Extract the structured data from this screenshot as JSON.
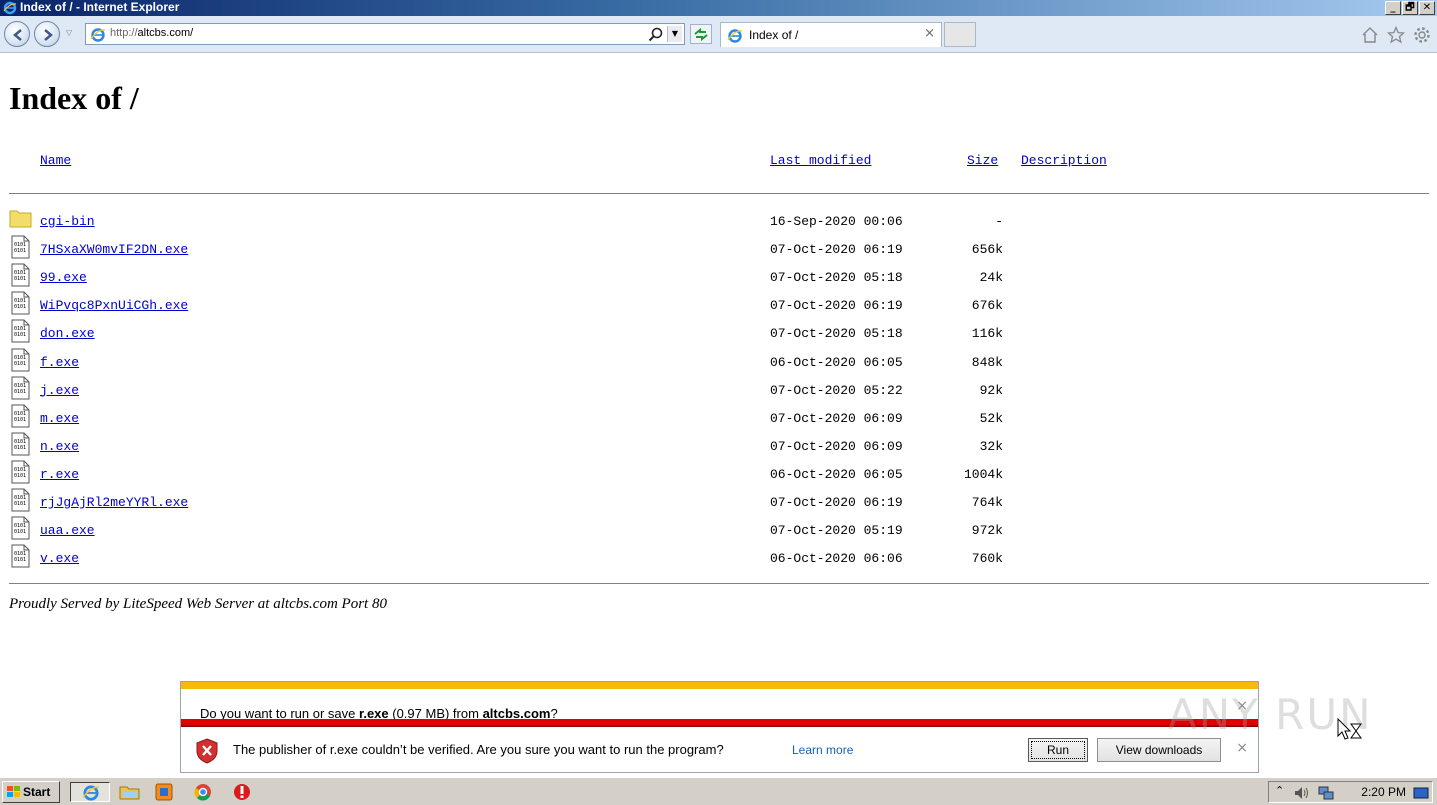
{
  "window": {
    "title": "Index of / - Internet Explorer",
    "controls": [
      "_",
      "🗗",
      "✕"
    ]
  },
  "navbar": {
    "url_proto": "http://",
    "url_host": "altcbs.com/",
    "tab_label": "Index of /",
    "tab_close": "×"
  },
  "page": {
    "heading": "Index of /",
    "columns": {
      "name": "Name",
      "modified": "Last modified",
      "size": "Size",
      "description": "Description"
    },
    "rows": [
      {
        "name": "cgi-bin",
        "date": "16-Sep-2020 00:06",
        "size": "-",
        "type": "folder"
      },
      {
        "name": "7HSxaXW0mvIF2DN.exe",
        "date": "07-Oct-2020 06:19",
        "size": "656k",
        "type": "file"
      },
      {
        "name": "99.exe",
        "date": "07-Oct-2020 05:18",
        "size": "24k",
        "type": "file"
      },
      {
        "name": "WiPvqc8PxnUiCGh.exe",
        "date": "07-Oct-2020 06:19",
        "size": "676k",
        "type": "file"
      },
      {
        "name": "don.exe",
        "date": "07-Oct-2020 05:18",
        "size": "116k",
        "type": "file"
      },
      {
        "name": "f.exe",
        "date": "06-Oct-2020 06:05",
        "size": "848k",
        "type": "file"
      },
      {
        "name": "j.exe",
        "date": "07-Oct-2020 05:22",
        "size": "92k",
        "type": "file"
      },
      {
        "name": "m.exe",
        "date": "07-Oct-2020 06:09",
        "size": "52k",
        "type": "file"
      },
      {
        "name": "n.exe",
        "date": "07-Oct-2020 06:09",
        "size": "32k",
        "type": "file"
      },
      {
        "name": "r.exe",
        "date": "06-Oct-2020 06:05",
        "size": "1004k",
        "type": "file"
      },
      {
        "name": "rjJgAjRl2meYYRl.exe",
        "date": "07-Oct-2020 06:19",
        "size": "764k",
        "type": "file"
      },
      {
        "name": "uaa.exe",
        "date": "07-Oct-2020 05:19",
        "size": "972k",
        "type": "file"
      },
      {
        "name": "v.exe",
        "date": "06-Oct-2020 06:06",
        "size": "760k",
        "type": "file"
      }
    ],
    "footer": "Proudly Served by LiteSpeed Web Server at altcbs.com Port 80"
  },
  "download_bar": {
    "question_prefix": "Do you want to run or save ",
    "file": "r.exe",
    "question_mid": " (0.97 MB) from ",
    "host": "altcbs.com",
    "question_suffix": "?",
    "warning": "The publisher of r.exe couldn’t be verified. Are you sure you want to run the program?",
    "learn_more": "Learn more",
    "run": "Run",
    "view_downloads": "View downloads",
    "close": "×"
  },
  "watermark": "ANY RUN",
  "taskbar": {
    "start": "Start",
    "clock": "2:20 PM"
  }
}
